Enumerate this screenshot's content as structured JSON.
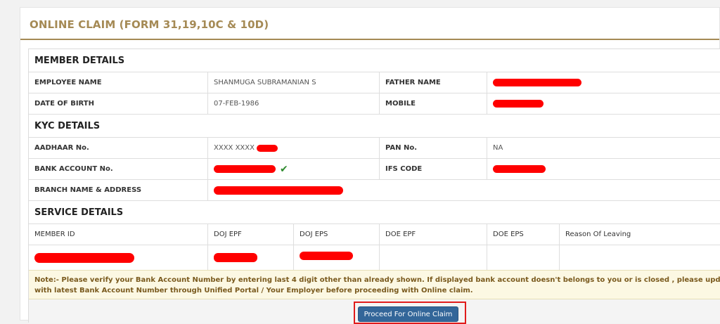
{
  "panel": {
    "title": "ONLINE CLAIM (FORM 31,19,10C & 10D)"
  },
  "member_details": {
    "heading": "MEMBER DETAILS",
    "employee_name_label": "EMPLOYEE NAME",
    "employee_name": "SHANMUGA SUBRAMANIAN S",
    "father_name_label": "FATHER NAME",
    "dob_label": "DATE OF BIRTH",
    "dob": "07-FEB-1986",
    "mobile_label": "MOBILE"
  },
  "kyc_details": {
    "heading": "KYC DETAILS",
    "aadhaar_label": "AADHAAR No.",
    "aadhaar_prefix": "XXXX XXXX",
    "pan_label": "PAN No.",
    "pan": "NA",
    "bank_account_label": "BANK ACCOUNT No.",
    "ifsc_label": "IFS CODE",
    "branch_label": "BRANCH NAME & ADDRESS",
    "verified_icon": "check-icon",
    "verified_glyph": "✔"
  },
  "service_details": {
    "heading": "SERVICE DETAILS",
    "columns": [
      "MEMBER ID",
      "DOJ EPF",
      "DOJ EPS",
      "DOE EPF",
      "DOE EPS",
      "Reason Of Leaving"
    ]
  },
  "note": {
    "line1": "Note:- Please verify your Bank Account Number by entering last 4 digit other than already shown. If displayed bank account doesn't belongs to you or is closed , please update bank details(",
    "line2": "with latest Bank Account Number through Unified Portal / Your Employer before proceeding with Online claim."
  },
  "actions": {
    "proceed_label": "Proceed For Online Claim"
  },
  "colors": {
    "accent": "#a58a55",
    "button": "#336699",
    "redaction": "#ff0000",
    "note_bg": "#fcf8e3"
  }
}
